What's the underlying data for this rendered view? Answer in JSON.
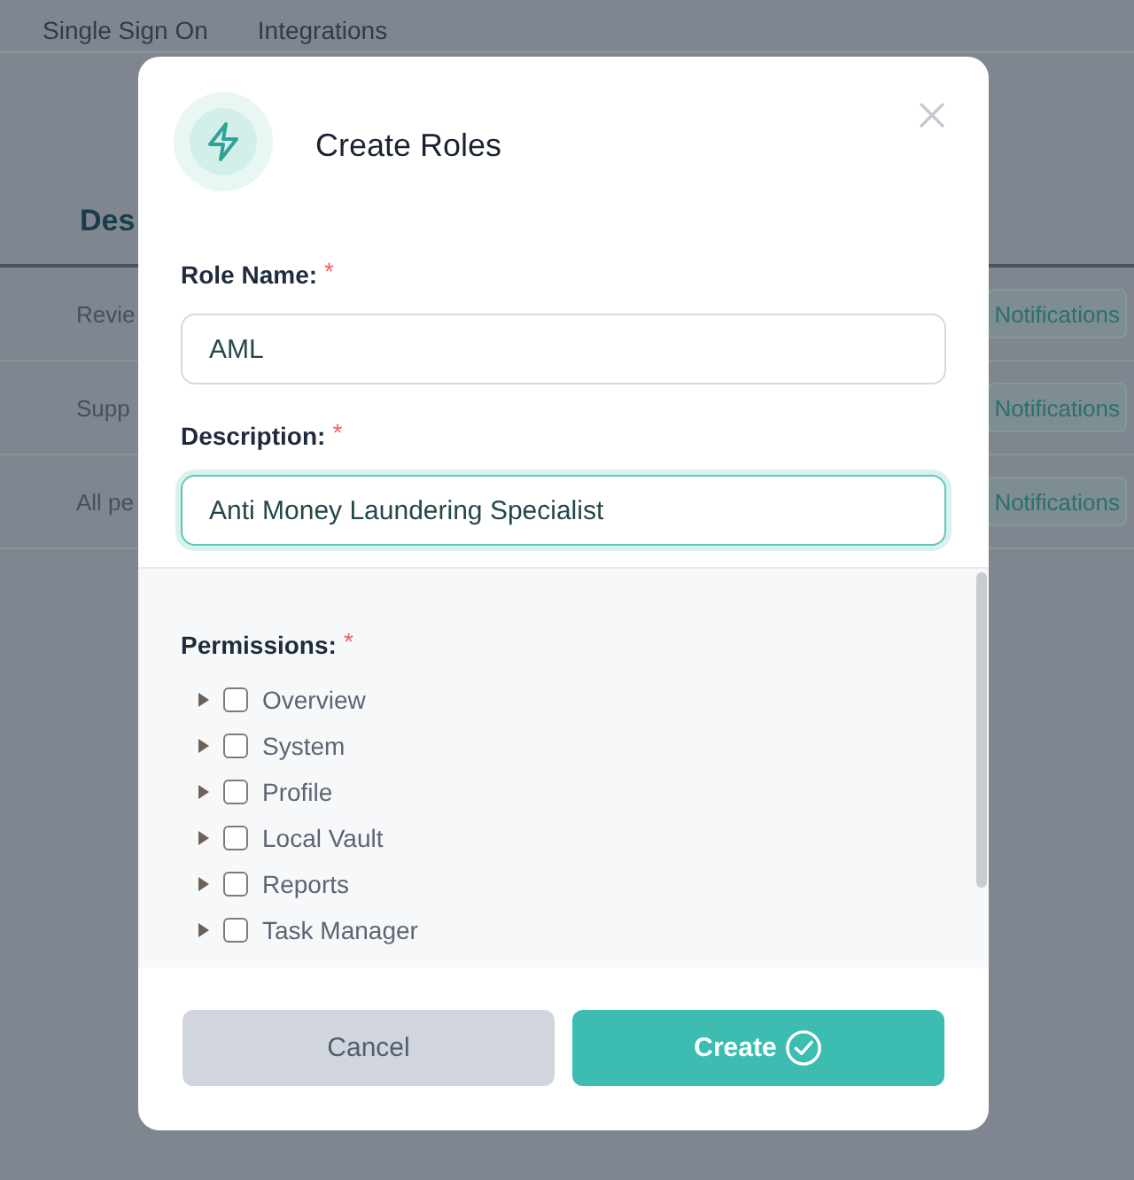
{
  "background": {
    "tabs": [
      {
        "label": "Single Sign On"
      },
      {
        "label": "Integrations"
      }
    ],
    "table": {
      "columns": [
        "Des"
      ],
      "rows": [
        {
          "column_1": "Revie",
          "column_2": "Notifications"
        },
        {
          "column_1": "Supp",
          "column_2": "Notifications"
        },
        {
          "column_1": "All pe",
          "column_2": "Notifications"
        }
      ]
    }
  },
  "dialog": {
    "title": "Create Roles",
    "fields": [
      {
        "label": "Role Name:",
        "required_mark": "*",
        "value": "AML",
        "focused": false
      },
      {
        "label": "Description:",
        "required_mark": "*",
        "value": "Anti Money Laundering Specialist",
        "focused": true
      }
    ],
    "permissions": {
      "label": "Permissions:",
      "required_mark": "*",
      "items": [
        {
          "label": "Overview",
          "checked": false,
          "expanded": false
        },
        {
          "label": "System",
          "checked": false,
          "expanded": false
        },
        {
          "label": "Profile",
          "checked": false,
          "expanded": false
        },
        {
          "label": "Local Vault",
          "checked": false,
          "expanded": false
        },
        {
          "label": "Reports",
          "checked": false,
          "expanded": false
        },
        {
          "label": "Task Manager",
          "checked": false,
          "expanded": false
        }
      ]
    },
    "buttons": [
      {
        "label": "Cancel",
        "kind": "secondary"
      },
      {
        "label": "Create",
        "kind": "primary"
      }
    ]
  }
}
